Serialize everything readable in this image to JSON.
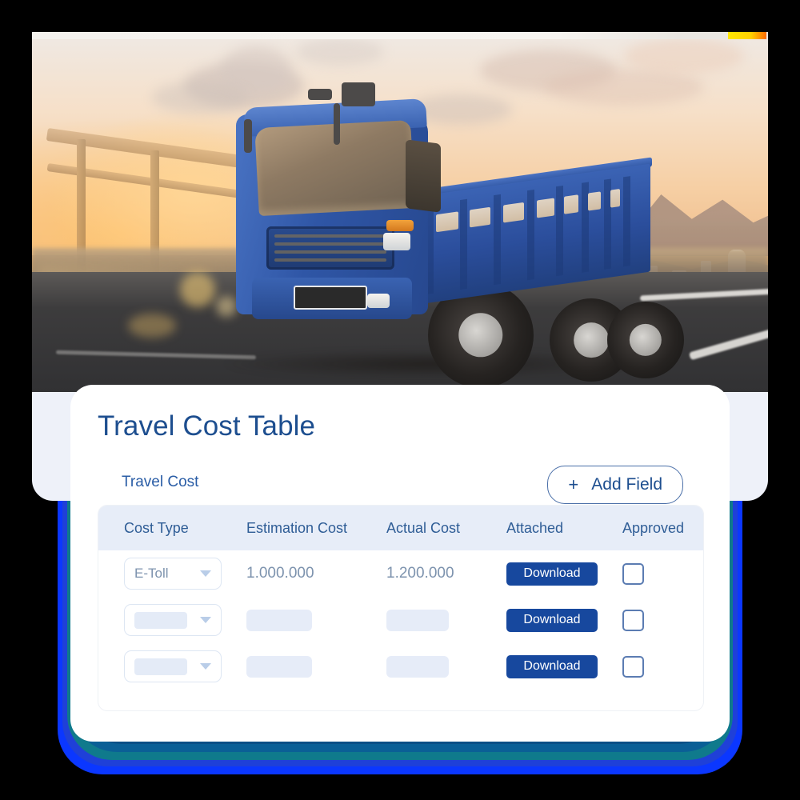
{
  "hero": {
    "alt": "blue-cargo-truck-on-highway-at-sunset",
    "accent_color": "#ffd000"
  },
  "card": {
    "title": "Travel Cost Table",
    "subtitle": "Travel Cost",
    "add_field": {
      "plus": "+",
      "label": "Add Field"
    }
  },
  "table": {
    "headers": [
      "Cost Type",
      "Estimation Cost",
      "Actual Cost",
      "Attached",
      "Approved"
    ],
    "rows": [
      {
        "cost_type": "E-Toll",
        "estimation_cost": "1.000.000",
        "actual_cost": "1.200.000",
        "attached_label": "Download",
        "approved": false,
        "placeholder": false
      },
      {
        "cost_type": "",
        "estimation_cost": "",
        "actual_cost": "",
        "attached_label": "Download",
        "approved": false,
        "placeholder": true
      },
      {
        "cost_type": "",
        "estimation_cost": "",
        "actual_cost": "",
        "attached_label": "Download",
        "approved": false,
        "placeholder": true
      }
    ]
  },
  "theme": {
    "primary": "#17489e",
    "title_color": "#1d4e8f",
    "header_band": "#e7edf8",
    "muted_text": "#7d93ae"
  }
}
